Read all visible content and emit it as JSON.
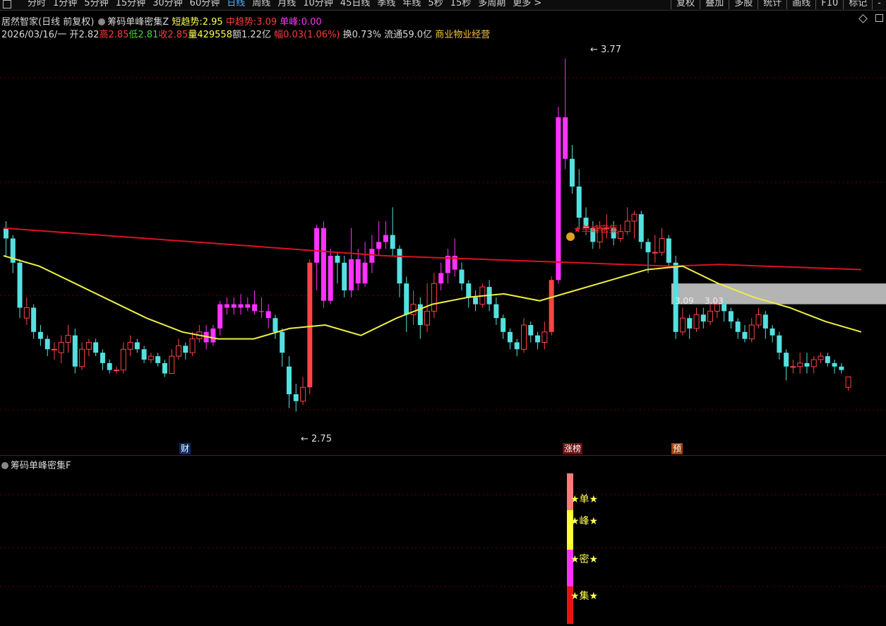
{
  "toolbar": {
    "periods": [
      "分时",
      "1分钟",
      "5分钟",
      "15分钟",
      "30分钟",
      "60分钟",
      "日线",
      "周线",
      "月线",
      "10分钟",
      "45日线",
      "季线",
      "年线",
      "5秒",
      "15秒",
      "多周期",
      "更多 >"
    ],
    "active_period": "日线",
    "right_buttons": [
      "复权",
      "叠加",
      "多股",
      "统计",
      "画线",
      "F10",
      "标记",
      "-"
    ]
  },
  "header": {
    "stock": "居然智家(日线 前复权)",
    "indicator": "筹码单峰密集Z",
    "short_label": "短趋势:",
    "short_value": "2.95",
    "mid_label": "中趋势:",
    "mid_value": "3.09",
    "peak_label": "单峰:",
    "peak_value": "0.00",
    "date": "2026/03/16/一",
    "open_label": "开",
    "open": "2.82",
    "high_label": "高",
    "high": "2.85",
    "low_label": "低",
    "low": "2.81",
    "close_label": "收",
    "close": "2.85",
    "vol_label": "量",
    "vol": "429558",
    "amt_label": "额",
    "amt": "1.22亿",
    "chg_label": "幅",
    "chg": "0.03(1.06%)",
    "turn_label": "换",
    "turn": "0.73%",
    "float_label": "流通",
    "float": "59.0亿",
    "industry": "商业物业经营"
  },
  "chart_labels": {
    "high_mark": "3.77",
    "low_mark": "2.75",
    "signal_text": "★单峰密集",
    "ma_label_1": "3.09",
    "ma_label_2": "3.03"
  },
  "event_tags": {
    "cai": "财",
    "zhangbang": "涨榜",
    "yu": "预"
  },
  "subchart": {
    "title": "筹码单峰密集F",
    "labels": [
      "★单★",
      "★峰★",
      "★密★",
      "★集★"
    ]
  },
  "colors": {
    "up": "#ff4444",
    "down": "#55e0e0",
    "magenta": "#ff33ff",
    "ma_red": "#dd1122",
    "ma_yellow": "#eeee44",
    "box_gray": "#b4b4b4"
  },
  "chart_data": {
    "type": "candlestick",
    "y_range": [
      2.7,
      3.8
    ],
    "candles": [
      [
        3.28,
        3.25,
        3.3,
        3.2
      ],
      [
        3.25,
        3.18,
        3.26,
        3.15
      ],
      [
        3.18,
        3.05,
        3.19,
        3.02
      ],
      [
        3.02,
        3.05,
        3.08,
        3.0
      ],
      [
        3.05,
        2.98,
        3.06,
        2.96
      ],
      [
        2.98,
        2.96,
        3.0,
        2.94
      ],
      [
        2.96,
        2.93,
        2.97,
        2.91
      ],
      [
        2.93,
        2.93,
        2.95,
        2.9
      ],
      [
        2.92,
        2.95,
        2.97,
        2.89
      ],
      [
        2.95,
        2.97,
        3.0,
        2.92
      ],
      [
        2.97,
        2.88,
        2.99,
        2.86
      ],
      [
        2.88,
        2.93,
        2.95,
        2.87
      ],
      [
        2.93,
        2.95,
        2.96,
        2.91
      ],
      [
        2.95,
        2.92,
        2.96,
        2.91
      ],
      [
        2.92,
        2.89,
        2.93,
        2.87
      ],
      [
        2.89,
        2.87,
        2.9,
        2.86
      ],
      [
        2.87,
        2.87,
        2.88,
        2.86
      ],
      [
        2.87,
        2.93,
        2.95,
        2.86
      ],
      [
        2.93,
        2.95,
        2.97,
        2.91
      ],
      [
        2.95,
        2.93,
        2.96,
        2.92
      ],
      [
        2.93,
        2.9,
        2.94,
        2.89
      ],
      [
        2.9,
        2.91,
        2.92,
        2.89
      ],
      [
        2.91,
        2.89,
        2.92,
        2.88
      ],
      [
        2.89,
        2.86,
        2.9,
        2.85
      ],
      [
        2.86,
        2.91,
        2.93,
        2.86
      ],
      [
        2.91,
        2.94,
        2.96,
        2.9
      ],
      [
        2.94,
        2.92,
        2.95,
        2.9
      ],
      [
        2.92,
        2.96,
        2.98,
        2.91
      ],
      [
        2.96,
        2.98,
        3.0,
        2.95
      ],
      [
        2.98,
        2.95,
        3.0,
        2.93
      ],
      [
        2.95,
        2.99,
        3.0,
        2.94
      ],
      [
        2.99,
        3.06,
        3.07,
        2.97
      ],
      [
        3.06,
        3.05,
        3.08,
        3.03
      ],
      [
        3.05,
        3.06,
        3.08,
        3.03
      ],
      [
        3.06,
        3.05,
        3.09,
        3.03
      ],
      [
        3.05,
        3.06,
        3.08,
        3.04
      ],
      [
        3.06,
        3.04,
        3.1,
        3.03
      ],
      [
        3.04,
        3.04,
        3.08,
        3.02
      ],
      [
        3.04,
        3.02,
        3.06,
        2.99
      ],
      [
        3.02,
        2.98,
        3.03,
        2.96
      ],
      [
        2.98,
        2.92,
        2.99,
        2.88
      ],
      [
        2.88,
        2.8,
        2.91,
        2.76
      ],
      [
        2.8,
        2.78,
        2.83,
        2.75
      ],
      [
        2.78,
        2.82,
        2.85,
        2.77
      ],
      [
        2.82,
        3.18,
        3.19,
        2.8
      ],
      [
        3.18,
        3.28,
        3.29,
        3.1
      ],
      [
        3.28,
        3.07,
        3.3,
        3.05
      ],
      [
        3.07,
        3.2,
        3.22,
        3.06
      ],
      [
        3.2,
        3.18,
        3.21,
        3.12
      ],
      [
        3.18,
        3.1,
        3.2,
        3.08
      ],
      [
        3.1,
        3.19,
        3.28,
        3.08
      ],
      [
        3.19,
        3.12,
        3.22,
        3.1
      ],
      [
        3.12,
        3.18,
        3.24,
        3.11
      ],
      [
        3.18,
        3.22,
        3.26,
        3.15
      ],
      [
        3.22,
        3.24,
        3.3,
        3.2
      ],
      [
        3.24,
        3.26,
        3.3,
        3.22
      ],
      [
        3.26,
        3.22,
        3.34,
        3.2
      ],
      [
        3.22,
        3.12,
        3.23,
        3.08
      ],
      [
        3.12,
        3.03,
        3.14,
        2.98
      ],
      [
        3.03,
        3.06,
        3.1,
        3.0
      ],
      [
        3.06,
        3.0,
        3.08,
        2.96
      ],
      [
        3.0,
        3.04,
        3.12,
        2.98
      ],
      [
        3.04,
        3.12,
        3.15,
        3.02
      ],
      [
        3.12,
        3.15,
        3.18,
        3.1
      ],
      [
        3.15,
        3.2,
        3.22,
        3.12
      ],
      [
        3.2,
        3.16,
        3.25,
        3.14
      ],
      [
        3.16,
        3.12,
        3.18,
        3.1
      ],
      [
        3.12,
        3.08,
        3.13,
        3.05
      ],
      [
        3.08,
        3.06,
        3.1,
        3.04
      ],
      [
        3.06,
        3.11,
        3.12,
        3.05
      ],
      [
        3.11,
        3.06,
        3.13,
        3.04
      ],
      [
        3.06,
        3.02,
        3.08,
        3.0
      ],
      [
        3.02,
        2.98,
        3.03,
        2.96
      ],
      [
        2.98,
        2.95,
        2.99,
        2.93
      ],
      [
        2.95,
        2.93,
        2.96,
        2.91
      ],
      [
        2.93,
        3.0,
        3.02,
        2.92
      ],
      [
        3.0,
        2.97,
        3.01,
        2.95
      ],
      [
        2.97,
        2.95,
        2.98,
        2.93
      ],
      [
        2.95,
        2.98,
        3.01,
        2.93
      ],
      [
        2.98,
        3.13,
        3.14,
        2.97
      ],
      [
        3.13,
        3.6,
        3.63,
        3.12
      ],
      [
        3.6,
        3.48,
        3.77,
        3.45
      ],
      [
        3.48,
        3.4,
        3.52,
        3.38
      ],
      [
        3.4,
        3.31,
        3.45,
        3.28
      ],
      [
        3.31,
        3.28,
        3.34,
        3.26
      ],
      [
        3.28,
        3.24,
        3.3,
        3.22
      ],
      [
        3.24,
        3.28,
        3.3,
        3.22
      ],
      [
        3.28,
        3.28,
        3.32,
        3.25
      ],
      [
        3.28,
        3.25,
        3.3,
        3.23
      ],
      [
        3.25,
        3.27,
        3.29,
        3.24
      ],
      [
        3.27,
        3.3,
        3.34,
        3.26
      ],
      [
        3.3,
        3.32,
        3.33,
        3.25
      ],
      [
        3.32,
        3.24,
        3.33,
        3.22
      ],
      [
        3.24,
        3.21,
        3.25,
        3.15
      ],
      [
        3.21,
        3.21,
        3.26,
        3.18
      ],
      [
        3.21,
        3.25,
        3.28,
        3.2
      ],
      [
        3.25,
        3.18,
        3.26,
        3.17
      ],
      [
        3.18,
        2.98,
        3.2,
        2.96
      ],
      [
        2.98,
        3.02,
        3.05,
        2.97
      ],
      [
        3.02,
        2.99,
        3.03,
        2.96
      ],
      [
        2.99,
        3.03,
        3.05,
        2.98
      ],
      [
        3.03,
        3.01,
        3.05,
        2.99
      ],
      [
        3.01,
        3.04,
        3.06,
        3.0
      ],
      [
        3.04,
        3.06,
        3.08,
        3.02
      ],
      [
        3.06,
        3.04,
        3.08,
        3.01
      ],
      [
        3.04,
        3.01,
        3.05,
        2.99
      ],
      [
        3.01,
        2.98,
        3.02,
        2.96
      ],
      [
        2.98,
        2.96,
        3.0,
        2.95
      ],
      [
        2.96,
        3.0,
        3.02,
        2.95
      ],
      [
        3.0,
        3.03,
        3.05,
        2.99
      ],
      [
        3.03,
        2.99,
        3.04,
        2.96
      ],
      [
        2.99,
        2.97,
        3.0,
        2.95
      ],
      [
        2.97,
        2.92,
        2.98,
        2.9
      ],
      [
        2.92,
        2.88,
        2.93,
        2.84
      ],
      [
        2.88,
        2.88,
        2.9,
        2.86
      ],
      [
        2.88,
        2.89,
        2.92,
        2.86
      ],
      [
        2.89,
        2.88,
        2.92,
        2.86
      ],
      [
        2.88,
        2.9,
        2.91,
        2.86
      ],
      [
        2.9,
        2.91,
        2.92,
        2.89
      ],
      [
        2.91,
        2.89,
        2.92,
        2.88
      ],
      [
        2.89,
        2.88,
        2.9,
        2.86
      ],
      [
        2.88,
        2.87,
        2.89,
        2.86
      ],
      [
        2.82,
        2.85,
        2.85,
        2.81
      ]
    ],
    "magenta_ranges": [
      [
        29,
        38
      ],
      [
        45,
        47
      ],
      [
        50,
        55
      ],
      [
        63,
        65
      ],
      [
        80,
        81
      ]
    ],
    "ma_red": [
      3.28,
      3.27,
      3.26,
      3.25,
      3.24,
      3.23,
      3.22,
      3.21,
      3.2,
      3.195,
      3.19,
      3.185,
      3.18,
      3.175,
      3.17,
      3.175,
      3.17,
      3.165,
      3.16
    ],
    "ma_yellow": [
      3.2,
      3.17,
      3.12,
      3.07,
      3.02,
      2.98,
      2.96,
      2.96,
      2.99,
      3.0,
      2.97,
      3.02,
      3.06,
      3.08,
      3.09,
      3.07,
      3.1,
      3.13,
      3.16,
      3.17,
      3.12,
      3.08,
      3.05,
      3.01,
      2.98
    ],
    "gray_box": [
      3.12,
      3.06
    ]
  }
}
